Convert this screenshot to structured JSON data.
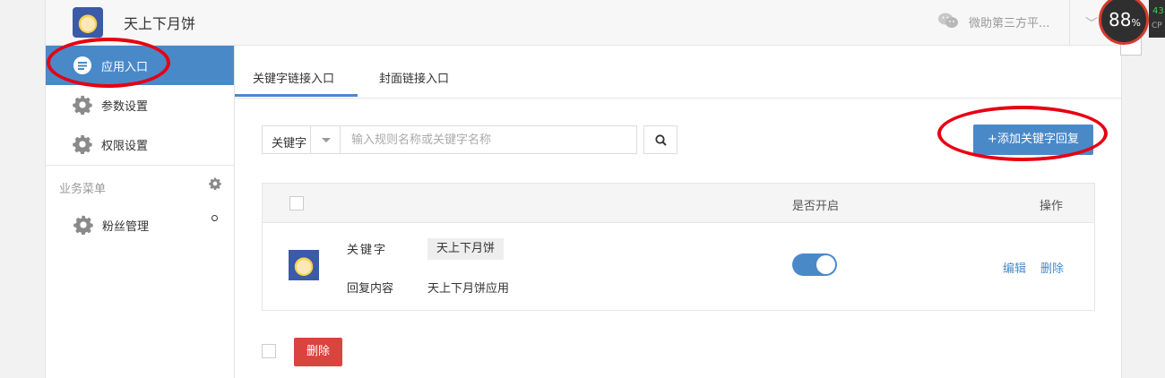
{
  "header": {
    "title": "天上下月饼",
    "third_party": "微助第三方平...",
    "chevron": "chevron-down-icon"
  },
  "sidebar": {
    "items": [
      {
        "label": "应用入口",
        "icon": "chat-icon",
        "active": true
      },
      {
        "label": "参数设置",
        "icon": "gear-icon"
      },
      {
        "label": "权限设置",
        "icon": "gear-icon"
      }
    ],
    "section_title": "业务菜单",
    "section_items": [
      {
        "label": "粉丝管理",
        "icon": "gear-icon"
      }
    ]
  },
  "tabs": [
    {
      "label": "关键字链接入口",
      "active": true
    },
    {
      "label": "封面链接入口",
      "active": false
    }
  ],
  "filter": {
    "select_value": "关键字",
    "search_placeholder": "输入规则名称或关键字名称"
  },
  "add_button": "+添加关键字回复",
  "table": {
    "headers": {
      "enabled": "是否开启",
      "actions": "操作"
    },
    "rows": [
      {
        "keyword_label": "关键字",
        "keyword": "天上下月饼",
        "reply_label": "回复内容",
        "reply": "天上下月饼应用",
        "enabled": true,
        "edit": "编辑",
        "delete": "删除"
      }
    ]
  },
  "bulk_delete": "删除",
  "perf_widget": {
    "value": "88",
    "unit": "%",
    "side_value": "43",
    "side_label": "CP"
  },
  "colors": {
    "accent": "#4a89c8",
    "danger": "#d9443f",
    "annotation": "#e60012"
  }
}
